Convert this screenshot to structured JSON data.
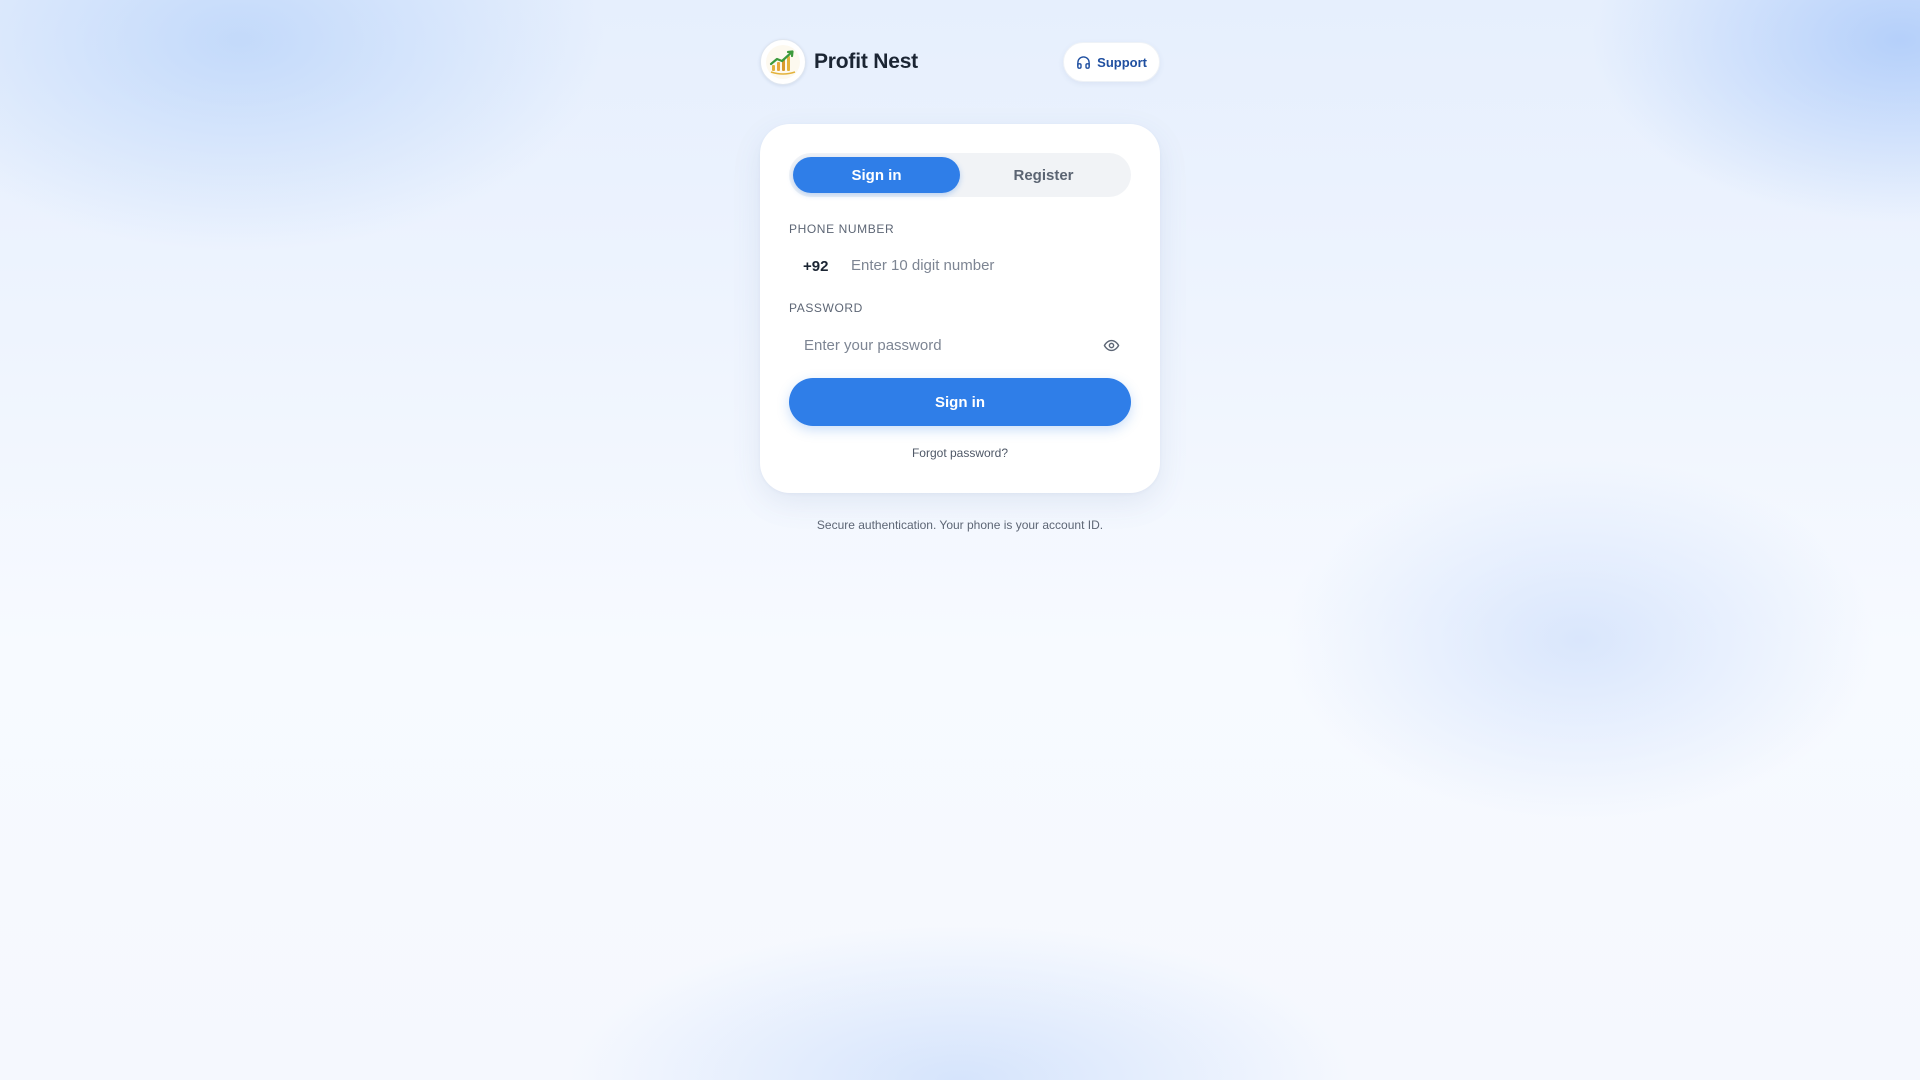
{
  "brand": {
    "name": "Profit Nest",
    "logo_icon": "rising-chart-icon"
  },
  "header": {
    "support_label": "Support",
    "support_icon": "headphones-icon"
  },
  "auth_card": {
    "tabs": [
      {
        "label": "Sign in",
        "active": true
      },
      {
        "label": "Register",
        "active": false
      }
    ],
    "phone": {
      "label": "PHONE NUMBER",
      "country_code": "+92",
      "value": "",
      "placeholder": "Enter 10 digit number"
    },
    "password": {
      "label": "PASSWORD",
      "value": "",
      "placeholder": "Enter your password",
      "toggle_icon": "eye-icon"
    },
    "submit_label": "Sign in",
    "forgot_label": "Forgot password?"
  },
  "footnote": "Secure authentication. Your phone is your account ID.",
  "colors": {
    "primary": "#2f7ee8",
    "support_text": "#1f4fa0",
    "text_dark": "#1b2533"
  }
}
